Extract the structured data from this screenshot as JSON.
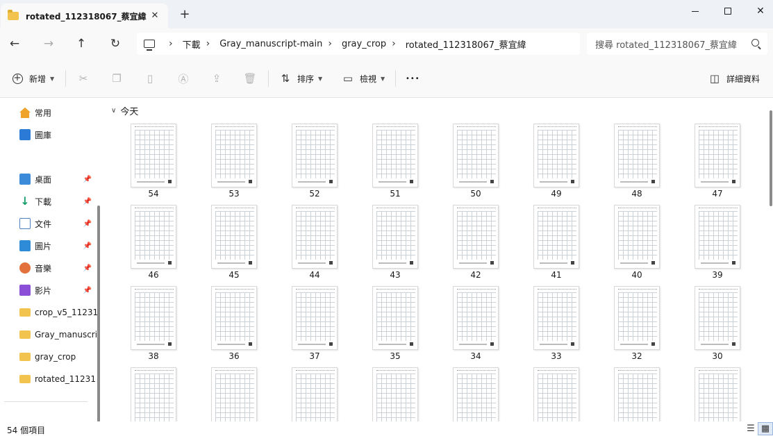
{
  "window": {
    "tab_title": "rotated_112318067_蔡宜緯",
    "tab_close": "✕",
    "new_tab": "+",
    "minimize_icon": "minimize",
    "maximize_icon": "maximize",
    "close_glyph": "✕"
  },
  "nav": {
    "back": "←",
    "forward": "→",
    "up": "↑",
    "refresh": "↻",
    "breadcrumbs": [
      "下載",
      "Gray_manuscript-main",
      "gray_crop",
      "rotated_112318067_蔡宜緯"
    ],
    "search_placeholder": "搜尋 rotated_112318067_蔡宜緯"
  },
  "toolbar": {
    "new_label": "新增",
    "sort_label": "排序",
    "view_label": "檢視",
    "more": "•••",
    "details_label": "詳細資料",
    "icons": [
      "cut-icon",
      "copy-icon",
      "paste-icon",
      "rename-icon",
      "share-icon",
      "delete-icon"
    ]
  },
  "sidebar": {
    "items": [
      {
        "label": "常用",
        "icon": "home-icon"
      },
      {
        "label": "圖庫",
        "icon": "gallery-icon"
      },
      {
        "label": "桌面",
        "icon": "desktop-icon",
        "pinned": true
      },
      {
        "label": "下載",
        "icon": "download-icon",
        "pinned": true
      },
      {
        "label": "文件",
        "icon": "document-icon",
        "pinned": true
      },
      {
        "label": "圖片",
        "icon": "pictures-icon",
        "pinned": true
      },
      {
        "label": "音樂",
        "icon": "music-icon",
        "pinned": true
      },
      {
        "label": "影片",
        "icon": "video-icon",
        "pinned": true
      },
      {
        "label": "crop_v5_11231",
        "icon": "folder-icon"
      },
      {
        "label": "Gray_manuscrip",
        "icon": "folder-icon"
      },
      {
        "label": "gray_crop",
        "icon": "folder-icon"
      },
      {
        "label": "rotated_11231",
        "icon": "folder-icon"
      }
    ],
    "pin_glyph": "📌"
  },
  "main": {
    "group_label": "今天",
    "files": [
      "54",
      "53",
      "52",
      "51",
      "50",
      "49",
      "48",
      "47",
      "46",
      "45",
      "44",
      "43",
      "42",
      "41",
      "40",
      "39",
      "38",
      "36",
      "37",
      "35",
      "34",
      "33",
      "32",
      "30",
      "",
      "",
      "",
      "",
      "",
      "",
      "",
      ""
    ]
  },
  "status": {
    "item_count": "54 個項目"
  },
  "colors": {
    "accent": "#2b7bd6",
    "folder": "#f2c44f",
    "chrome_bg": "#eef2f7"
  }
}
